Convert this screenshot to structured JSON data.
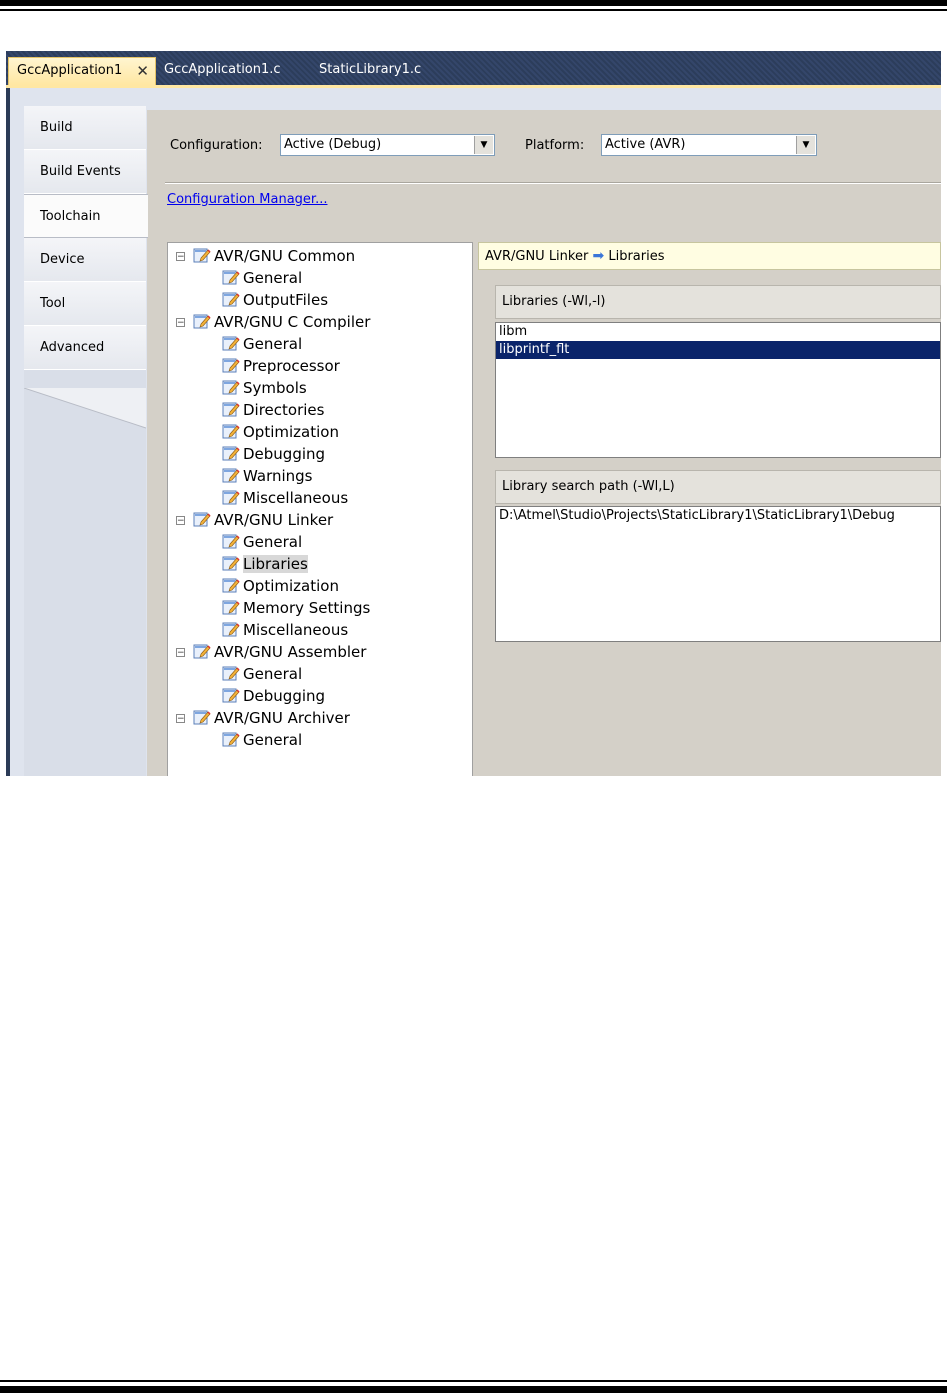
{
  "tabs": [
    {
      "label": "GccApplication1",
      "active": true,
      "close": "✕"
    },
    {
      "label": "GccApplication1.c",
      "active": false
    },
    {
      "label": "StaticLibrary1.c",
      "active": false
    }
  ],
  "nav": [
    "Build",
    "Build Events",
    "Toolchain",
    "Device",
    "Tool",
    "Advanced"
  ],
  "nav_active": "Toolchain",
  "config": {
    "configuration_label": "Configuration:",
    "configuration_value": "Active (Debug)",
    "platform_label": "Platform:",
    "platform_value": "Active (AVR)",
    "manager_link": "Configuration Manager..."
  },
  "tree": [
    {
      "label": "AVR/GNU Common",
      "children": [
        "General",
        "OutputFiles"
      ]
    },
    {
      "label": "AVR/GNU C Compiler",
      "children": [
        "General",
        "Preprocessor",
        "Symbols",
        "Directories",
        "Optimization",
        "Debugging",
        "Warnings",
        "Miscellaneous"
      ]
    },
    {
      "label": "AVR/GNU Linker",
      "children": [
        "General",
        "Libraries",
        "Optimization",
        "Memory Settings",
        "Miscellaneous"
      ]
    },
    {
      "label": "AVR/GNU Assembler",
      "children": [
        "General",
        "Debugging"
      ]
    },
    {
      "label": "AVR/GNU Archiver",
      "children": [
        "General"
      ]
    }
  ],
  "selected_node": "AVR/GNU Linker/Libraries",
  "breadcrumb": {
    "parent": "AVR/GNU Linker",
    "arrow": "➡",
    "child": "Libraries"
  },
  "libraries": {
    "header": "Libraries (-Wl,-l)",
    "items": [
      "libm",
      "libprintf_flt"
    ],
    "selected": "libprintf_flt"
  },
  "search_path": {
    "header": "Library search path (-Wl,L)",
    "items": [
      "D:\\Atmel\\Studio\\Projects\\StaticLibrary1\\StaticLibrary1\\Debug"
    ]
  },
  "colors": {
    "accent_selection": "#0a246a",
    "tab_active": "#ffe7a2",
    "tab_strip": "#2b3b57",
    "link": "#0000ee"
  }
}
